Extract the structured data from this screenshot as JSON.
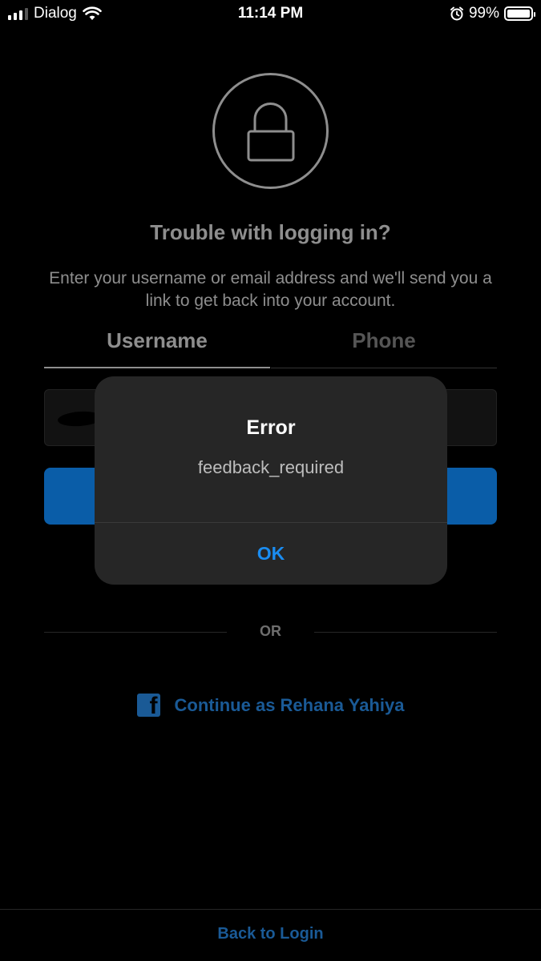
{
  "status_bar": {
    "carrier": "Dialog",
    "time": "11:14 PM",
    "battery_percent": "99%",
    "battery_level": 0.99
  },
  "main": {
    "heading": "Trouble with logging in?",
    "description": "Enter your username or email address and we'll send you a link to get back into your account.",
    "tabs": [
      {
        "label": "Username"
      },
      {
        "label": "Phone"
      }
    ],
    "divider_text": "OR",
    "facebook_label": "Continue as Rehana Yahiya",
    "back_to_login": "Back to Login"
  },
  "dialog": {
    "title": "Error",
    "message": "feedback_required",
    "ok_label": "OK"
  },
  "colors": {
    "accent": "#1a8cf0",
    "facebook": "#1a5a96",
    "button": "#0a5da8"
  },
  "icons": {
    "lock": "lock-icon",
    "facebook": "facebook-icon",
    "wifi": "wifi-icon",
    "alarm": "alarm-icon"
  }
}
